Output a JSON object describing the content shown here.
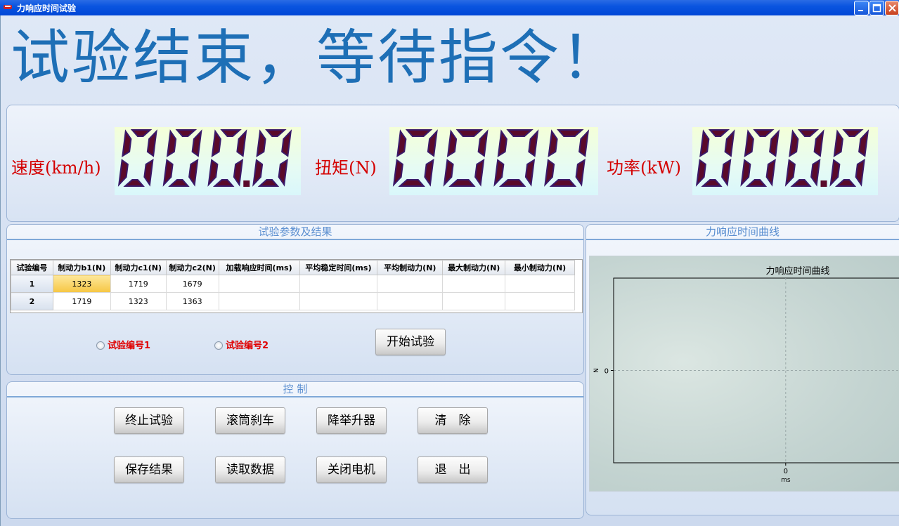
{
  "window": {
    "title": "力响应时间试验"
  },
  "status_banner": "试验结束，等待指令！",
  "readouts": [
    {
      "label": "速度(km/h)",
      "value": "000.0"
    },
    {
      "label": "扭矩(N)",
      "value": "0000"
    },
    {
      "label": "功率(kW)",
      "value": "000.0"
    }
  ],
  "params_group": {
    "title": "试验参数及结果",
    "columns": [
      "试验编号",
      "制动力b1(N)",
      "制动力c1(N)",
      "制动力c2(N)",
      "加载响应时间(ms)",
      "平均稳定时间(ms)",
      "平均制动力(N)",
      "最大制动力(N)",
      "最小制动力(N)"
    ],
    "rows": [
      [
        "1",
        "1323",
        "1719",
        "1679",
        "",
        "",
        "",
        "",
        ""
      ],
      [
        "2",
        "1719",
        "1323",
        "1363",
        "",
        "",
        "",
        "",
        ""
      ]
    ],
    "radio1_label": "试验编号1",
    "radio2_label": "试验编号2",
    "start_button": "开始试验"
  },
  "control_group": {
    "title": "控 制",
    "buttons": {
      "stop": "终止试验",
      "roller_brake": "滚筒刹车",
      "lift": "降举升器",
      "clear": "清　除",
      "save": "保存结果",
      "read": "读取数据",
      "motor_off": "关闭电机",
      "exit": "退　出"
    }
  },
  "chart_group": {
    "title": "力响应时间曲线"
  },
  "chart_data": {
    "type": "line",
    "title": "力响应时间曲线",
    "xlabel": "ms",
    "ylabel": "N",
    "x_ticks": [
      "0"
    ],
    "y_ticks": [
      "0"
    ],
    "series": [],
    "grid": true
  },
  "colors": {
    "banner": "#1e6fb6",
    "label_red": "#d40000",
    "digit_segment": "#5a0a2a",
    "group_title": "#5a8ed0"
  }
}
